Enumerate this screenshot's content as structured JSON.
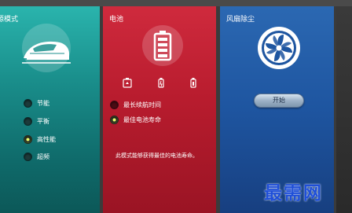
{
  "panels": {
    "mode": {
      "title": "源模式",
      "options": [
        {
          "label": "节能",
          "selected": false
        },
        {
          "label": "平衡",
          "selected": false
        },
        {
          "label": "高性能",
          "selected": true
        },
        {
          "label": "超频",
          "selected": false
        }
      ]
    },
    "battery": {
      "title": "电池",
      "options": [
        {
          "label": "最长续航时间",
          "selected": false
        },
        {
          "label": "最佳电池寿命",
          "selected": true
        }
      ],
      "description": "此模式能够获得最佳的电池寿命。"
    },
    "fan": {
      "title": "风扇除尘",
      "start_label": "开始"
    }
  },
  "watermark": "最需网",
  "colors": {
    "mode_panel": "#1a8f8c",
    "battery_panel": "#b81c2e",
    "fan_panel": "#1e55a0",
    "radio_selected": "#b8e83a"
  }
}
